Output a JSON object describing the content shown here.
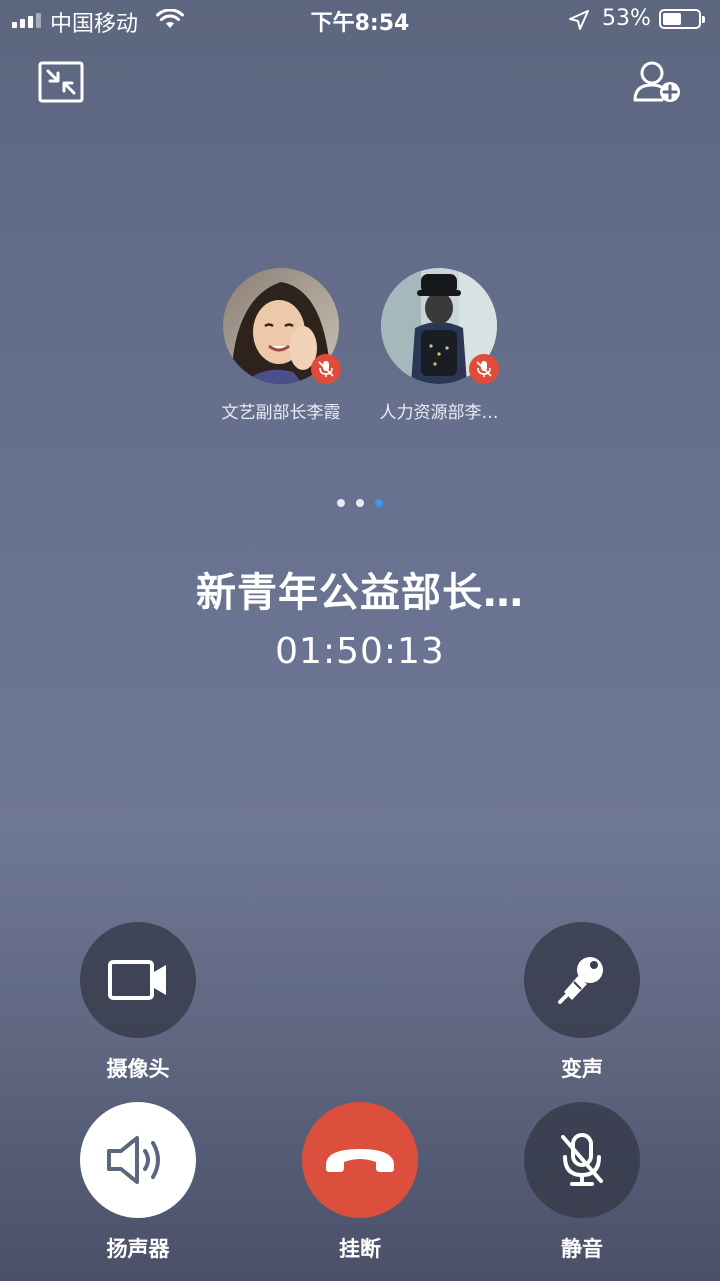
{
  "status_bar": {
    "carrier": "中国移动",
    "time": "下午8:54",
    "battery_percent": "53%",
    "battery_level": 0.53
  },
  "top_bar": {
    "minimize_icon": "minimize-window-icon",
    "add_member_icon": "add-person-icon"
  },
  "participants": [
    {
      "name": "文艺副部长李霞",
      "muted": true
    },
    {
      "name": "人力资源部李…",
      "muted": true
    }
  ],
  "pagination": {
    "pages": 3,
    "active": 3
  },
  "call": {
    "title": "新青年公益部长…",
    "duration": "01:50:13"
  },
  "controls": {
    "camera": {
      "label": "摄像头",
      "icon": "video-camera-icon"
    },
    "voice_changer": {
      "label": "变声",
      "icon": "microphone-effect-icon"
    },
    "speaker": {
      "label": "扬声器",
      "icon": "speaker-icon",
      "active": true
    },
    "hangup": {
      "label": "挂断",
      "icon": "hang-up-icon",
      "color": "#dc4f3c"
    },
    "mute": {
      "label": "静音",
      "icon": "mic-muted-icon"
    }
  },
  "colors": {
    "accent_dot": "#3f96e6",
    "mute_badge": "#e14b3b",
    "hangup": "#dc4f3c"
  }
}
